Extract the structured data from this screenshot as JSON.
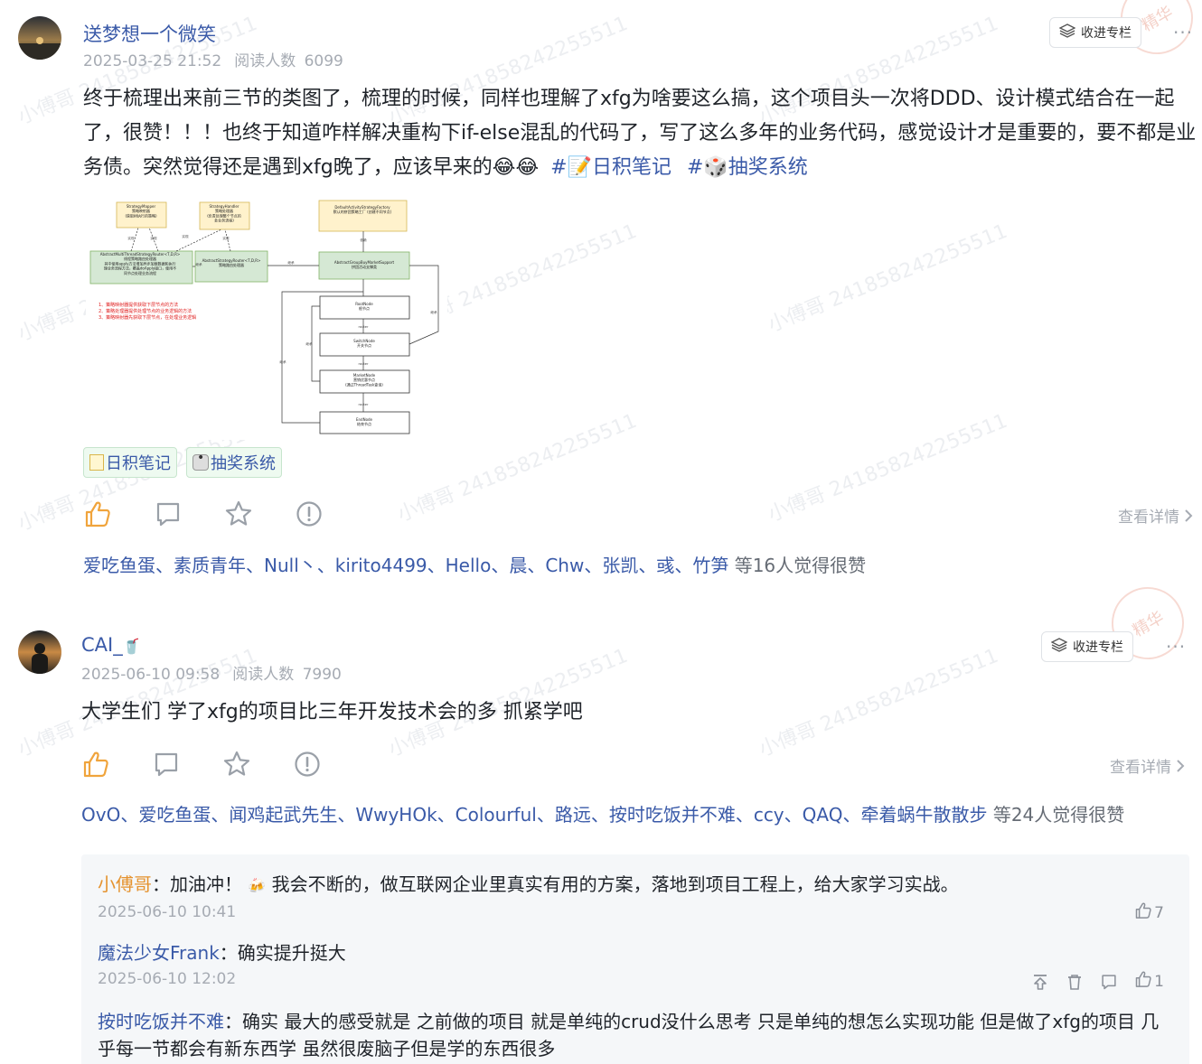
{
  "posts": [
    {
      "author": "送梦想一个微笑",
      "date": "2025-03-25 21:52",
      "read_label": "阅读人数",
      "read_count": "6099",
      "collect_label": "收进专栏",
      "more": "···",
      "stamp_text": "精华",
      "content": "终于梳理出来前三节的类图了，梳理的时候，同样也理解了xfg为啥要这么搞，这个项目头一次将DDD、设计模式结合在一起了，很赞！！！也终于知道咋样解决重构下if-else混乱的代码了，写了这么多年的业务代码，感觉设计才是重要的，要不都是业务债。突然觉得还是遇到xfg晚了，应该早来的",
      "emojis": "😂😂",
      "hashtags": [
        "#📝日积笔记",
        "#🎲抽奖系统"
      ],
      "tags": [
        "日积笔记",
        "抽奖系统"
      ],
      "detail_label": "查看详情",
      "likers_names": "爱吃鱼蛋、素质青年、Null丶、kirito4499、Hello、晨、Chw、张凯、彧、竹笋",
      "likers_suffix": "等16人觉得很赞",
      "diagram": {
        "boxes": [
          {
            "id": "mapper",
            "lines": [
              "StrategyMapper",
              "策略映射器",
              "(获取树执行的策略)"
            ]
          },
          {
            "id": "handler",
            "lines": [
              "StrategyHandler",
              "策略处理器",
              "(负责处理整个节点的",
              "处业务流程)"
            ]
          },
          {
            "id": "factory",
            "lines": [
              "DefaultActivityStrategyFactory",
              "默认的拼团策略工厂 (创建不同节点)"
            ]
          },
          {
            "id": "multi",
            "lines": [
              "AbstractMultiThreadStrategyRouter<T,D,R>",
              "线程策略路由处理器",
              "其中使用apply方法增加异步加载数据和执行",
              "理业务流程方法，覆盖doApply接口，使用不",
              "同节点处理业务流程"
            ]
          },
          {
            "id": "router",
            "lines": [
              "AbstractStrategyRouter<T,D,R>",
              "策略路由处理器"
            ]
          },
          {
            "id": "support",
            "lines": [
              "AbstractGroupBuyMarketSupport",
              "拼团活动支撑类"
            ]
          },
          {
            "id": "root",
            "lines": [
              "RootNode",
              "根节点"
            ]
          },
          {
            "id": "switch",
            "lines": [
              "SwitchNode",
              "开关节点"
            ]
          },
          {
            "id": "market",
            "lines": [
              "MarketNode",
              "营销优惠节点",
              "(通过ThreadTask查询)"
            ]
          },
          {
            "id": "end",
            "lines": [
              "EndNode",
              "结束节点"
            ]
          }
        ],
        "edge_labels": [
          "实现",
          "实现",
          "实现",
          "实现",
          "继承",
          "继承",
          "依赖",
          "继承",
          "继承",
          "继承",
          "router",
          "router",
          "router"
        ],
        "notes": [
          "1、策略映射器提供获取下层节点的方法",
          "2、策略处理器提供处理节点的业务逻辑的方法",
          "3、策略映射器先获取下层节点，在处理业务逻辑"
        ]
      }
    },
    {
      "author": "CAI_",
      "author_emoji": "🥤",
      "date": "2025-06-10 09:58",
      "read_label": "阅读人数",
      "read_count": "7990",
      "collect_label": "收进专栏",
      "more": "···",
      "stamp_text": "精华",
      "content": "大学生们 学了xfg的项目比三年开发技术会的多 抓紧学吧",
      "detail_label": "查看详情",
      "likers_names": "OvO、爱吃鱼蛋、闻鸡起武先生、WwyHOk、Colourful、路远、按时吃饭并不难、ccy、QAQ、牵着蜗牛散散步",
      "likers_suffix": "等24人觉得很赞",
      "replies": [
        {
          "name": "小傅哥",
          "text": "加油冲！",
          "emoji": "🍻",
          "text2": "我会不断的，做互联网企业里真实有用的方案，落地到项目工程上，给大家学习实战。",
          "time": "2025-06-10 10:41",
          "likes": "7"
        },
        {
          "name": "魔法少女Frank",
          "text": "确实提升挺大",
          "time": "2025-06-10 12:02",
          "likes": "1"
        },
        {
          "name": "按时吃饭并不难",
          "text": "确实 最大的感受就是 之前做的项目 就是单纯的crud没什么思考 只是单纯的想怎么实现功能 但是做了xfg的项目 几乎每一节都会有新东西学 虽然很废脑子但是学的东西很多"
        }
      ]
    }
  ],
  "watermark": "小傅哥 241858242255511"
}
